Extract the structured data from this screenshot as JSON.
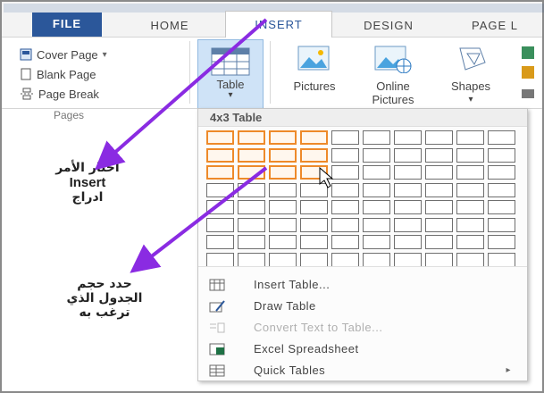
{
  "tabs": {
    "file": "FILE",
    "home": "HOME",
    "insert": "INSERT",
    "design": "DESIGN",
    "page_layout": "PAGE L"
  },
  "pages_group": {
    "items": [
      "Cover Page",
      "Blank Page",
      "Page Break"
    ],
    "cover_page_arrow": "▾",
    "label": "Pages"
  },
  "ribbon_buttons": {
    "table": "Table",
    "table_arrow": "▾",
    "pictures": "Pictures",
    "online_pictures_line1": "Online",
    "online_pictures_line2": "Pictures",
    "shapes": "Shapes",
    "shapes_arrow": "▾"
  },
  "dropdown": {
    "header": "4x3 Table",
    "grid_cols": 10,
    "grid_rows": 8,
    "selected_cols": 4,
    "selected_rows": 3,
    "menu": [
      {
        "label": "Insert Table...",
        "enabled": true,
        "submenu": false
      },
      {
        "label": "Draw Table",
        "enabled": true,
        "submenu": false
      },
      {
        "label": "Convert Text to Table...",
        "enabled": false,
        "submenu": false
      },
      {
        "label": "Excel Spreadsheet",
        "enabled": true,
        "submenu": false
      },
      {
        "label": "Quick Tables",
        "enabled": true,
        "submenu": true
      }
    ],
    "submenu_arrow": "▸"
  },
  "annotations": {
    "note1_line1": "اختار الأمر",
    "note1_line2": "Insert",
    "note1_line3": "ادراج",
    "note2_line1": "حدد حجم",
    "note2_line2": "الجدول الذي",
    "note2_line3": "ترغب به"
  },
  "colors": {
    "file_tab": "#2b579a",
    "grid_selected": "#ee8a2a",
    "annotation_arrow": "#8a2be2"
  }
}
